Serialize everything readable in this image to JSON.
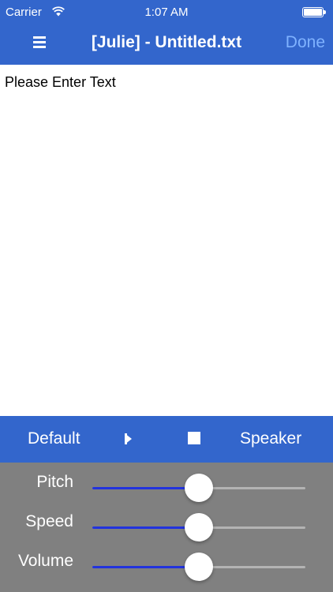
{
  "status_bar": {
    "carrier": "Carrier",
    "time": "1:07 AM",
    "wifi_icon": "wifi-icon",
    "battery_icon": "battery-icon"
  },
  "nav_bar": {
    "menu_icon": "hamburger-menu-icon",
    "title": "[Julie] - Untitled.txt",
    "done_label": "Done"
  },
  "editor": {
    "placeholder": "Please Enter Text",
    "value": ""
  },
  "controls": {
    "default_label": "Default",
    "play_icon": "play-icon",
    "stop_icon": "stop-icon",
    "speaker_label": "Speaker"
  },
  "sliders": [
    {
      "label": "Pitch",
      "value": 0.5
    },
    {
      "label": "Speed",
      "value": 0.5
    },
    {
      "label": "Volume",
      "value": 0.5
    }
  ],
  "colors": {
    "accent": "#3366cc",
    "done": "#7fb2ff",
    "panel": "#808080",
    "slider_fill": "#2233dd",
    "slider_track": "#b3b3b3"
  }
}
